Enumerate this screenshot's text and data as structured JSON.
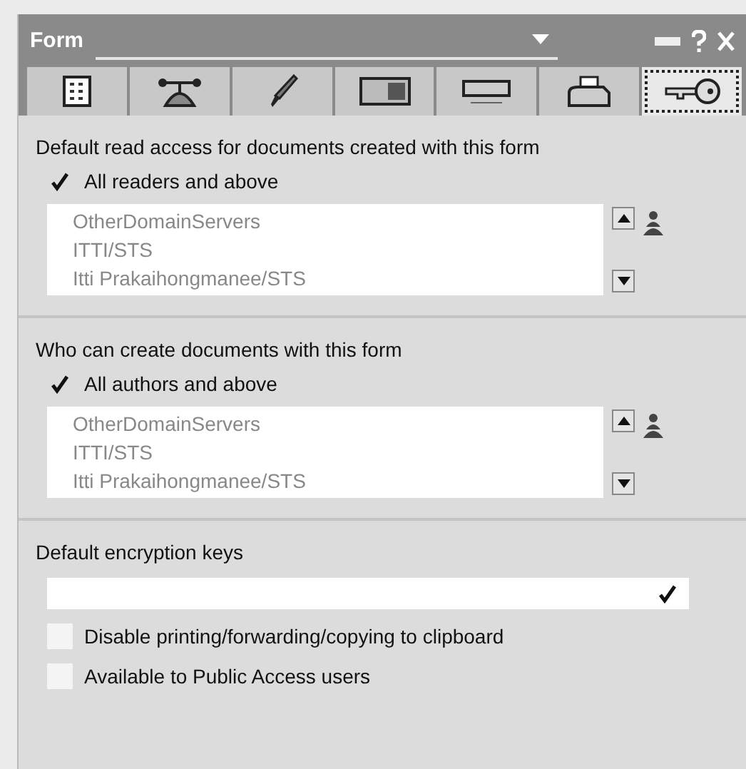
{
  "window": {
    "title": "Form"
  },
  "tabs": [
    {
      "kind": "info",
      "selected": false
    },
    {
      "kind": "launch",
      "selected": false
    },
    {
      "kind": "pen",
      "selected": false
    },
    {
      "kind": "card",
      "selected": false
    },
    {
      "kind": "header",
      "selected": false
    },
    {
      "kind": "printer",
      "selected": false
    },
    {
      "kind": "key",
      "selected": true
    }
  ],
  "access_sections": [
    {
      "title": "Default read access for documents created with this form",
      "option": {
        "label": "All readers and above",
        "checked": true
      },
      "names": [
        "OtherDomainServers",
        "ITTI/STS",
        "Itti Prakaihongmanee/STS"
      ]
    },
    {
      "title": "Who can create documents with this form",
      "option": {
        "label": "All authors and above",
        "checked": true
      },
      "names": [
        "OtherDomainServers",
        "ITTI/STS",
        "Itti Prakaihongmanee/STS"
      ]
    }
  ],
  "encryption": {
    "title": "Default encryption keys",
    "options": [
      {
        "label": "Disable printing/forwarding/copying to clipboard",
        "checked": false
      },
      {
        "label": "Available to Public Access users",
        "checked": false
      }
    ]
  }
}
